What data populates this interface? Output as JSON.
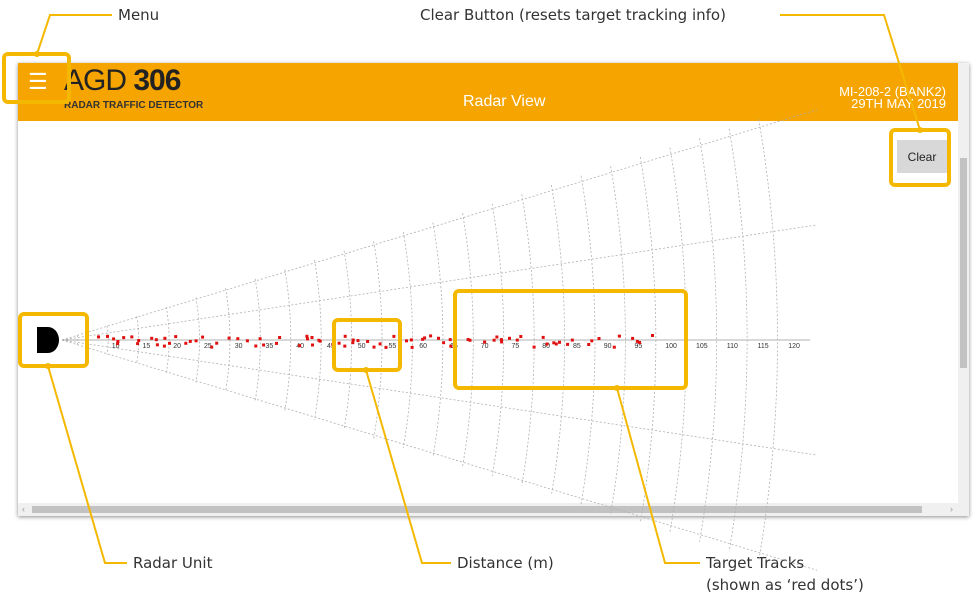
{
  "annotations": {
    "menu": "Menu",
    "clear": "Clear Button (resets target tracking info)",
    "radar_unit": "Radar Unit",
    "distance": "Distance (m)",
    "targets_line1": "Target Tracks",
    "targets_line2": "(shown as ‘red dots’)"
  },
  "header": {
    "logo_prefix": "AGD",
    "logo_number": "306",
    "logo_subtitle": "RADAR TRAFFIC DETECTOR",
    "title": "Radar View",
    "device_id": "MI-208-2 (BANK2)",
    "date": "29TH MAY 2019",
    "menu_glyph": "☰"
  },
  "clear_button": {
    "label": "Clear"
  },
  "radar": {
    "distance_labels": [
      "10",
      "15",
      "20",
      "25",
      "30",
      "35",
      "40",
      "45",
      "50",
      "55",
      "60",
      "65",
      "70",
      "75",
      "80",
      "85",
      "90",
      "95",
      "100",
      "105",
      "110",
      "115",
      "120"
    ],
    "colors": {
      "header": "#f5a400",
      "highlight": "#f5b800",
      "target": "#e01010",
      "grid": "#b0b0b0"
    }
  }
}
